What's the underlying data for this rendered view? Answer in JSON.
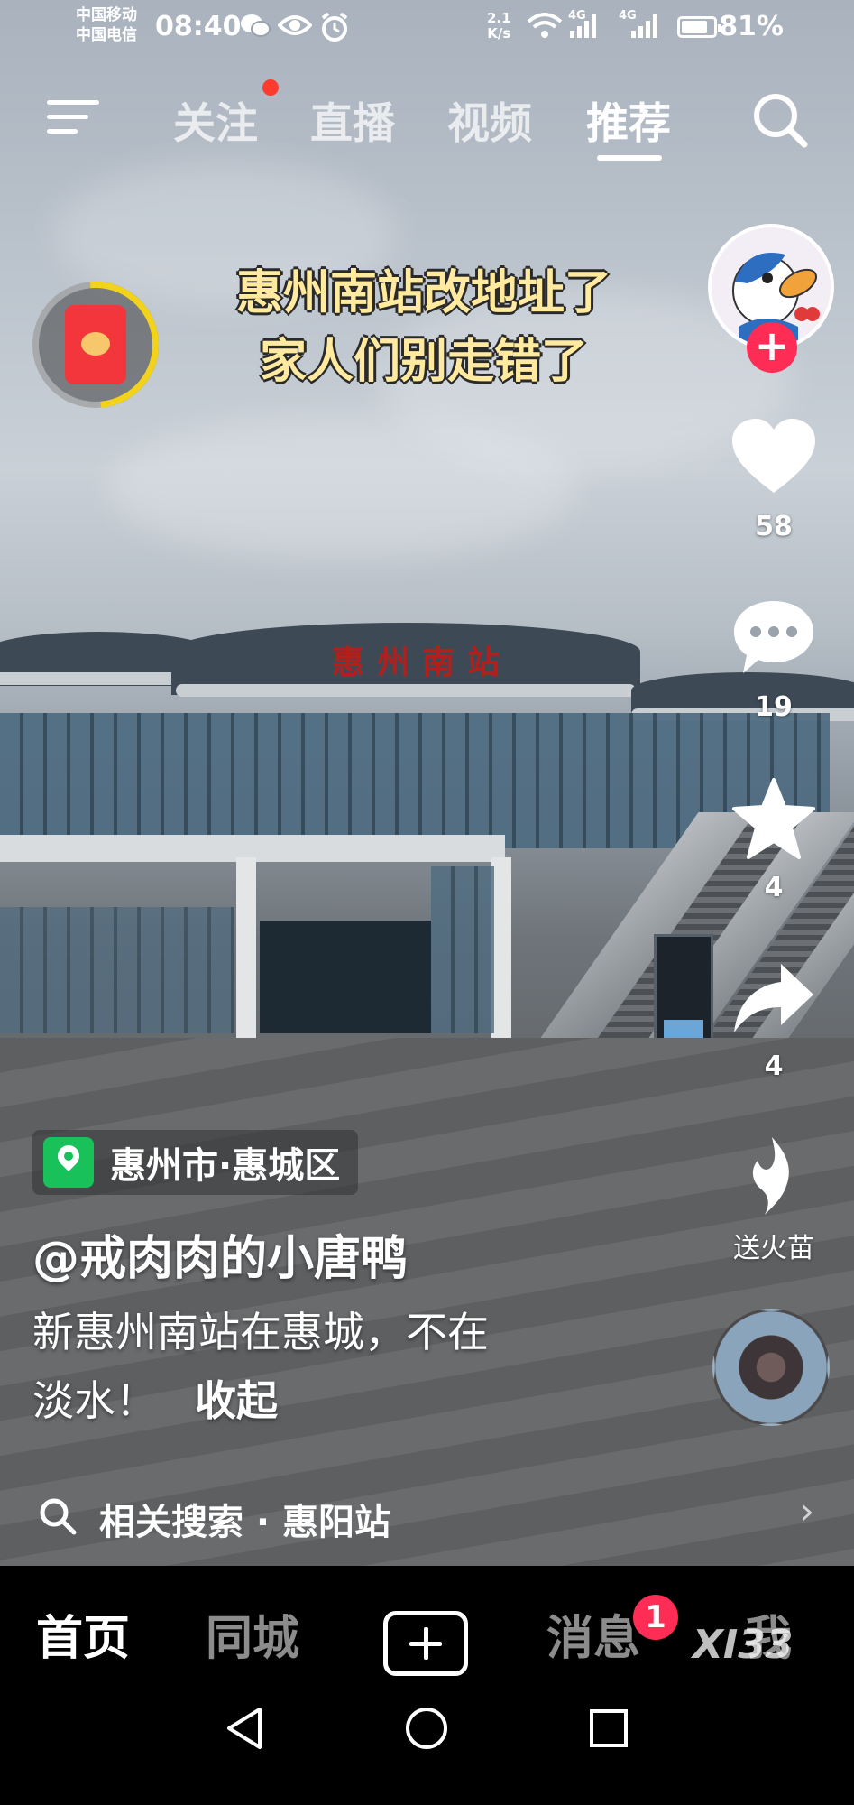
{
  "status_bar": {
    "carrier_1": "中国移动",
    "carrier_2": "中国电信",
    "time": "08:40",
    "net_speed_value": "2.1",
    "net_speed_unit": "K/s",
    "signal_1_label": "4G",
    "signal_2_label": "4G",
    "battery_percent": "81%",
    "battery_level": 0.81,
    "icons": [
      "wechat-icon",
      "eye-icon",
      "alarm-icon",
      "wifi-icon",
      "signal-icon",
      "battery-icon"
    ]
  },
  "top_nav": {
    "tabs": [
      {
        "label": "关注",
        "has_dot": true
      },
      {
        "label": "直播"
      },
      {
        "label": "视频"
      },
      {
        "label": "推荐",
        "active": true
      }
    ],
    "icons": [
      "menu-icon",
      "search-icon"
    ]
  },
  "video": {
    "caption_line_1": "惠州南站改地址了",
    "caption_line_2": "家人们别走错了",
    "station_sign": "惠州南站"
  },
  "right_rail": {
    "like_count": "58",
    "comment_count": "19",
    "favorite_count": "4",
    "share_count": "4",
    "fire_label": "送火苗"
  },
  "post": {
    "location": "惠州市·惠城区",
    "author": "@戒肉肉的小唐鸭",
    "description_line_1": "新惠州南站在惠城，不在",
    "description_line_2": "淡水！",
    "collapse_label": "收起",
    "related_search": "相关搜索 · 惠阳站"
  },
  "bottom_tabs": {
    "home": "首页",
    "nearby": "同城",
    "messages": "消息",
    "messages_badge": "1",
    "me": "我",
    "watermark": "XI33"
  },
  "colors": {
    "accent_red": "#ff2c55",
    "location_green": "#18c159",
    "caption_yellow": "#ffeaa0",
    "ring_yellow": "#f2d31a"
  }
}
